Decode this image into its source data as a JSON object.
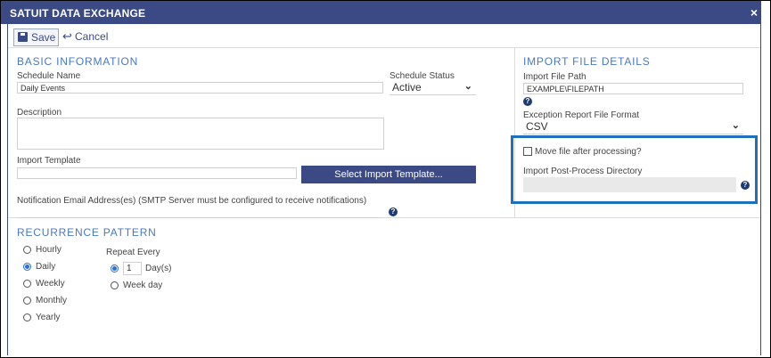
{
  "window": {
    "title": "SATUIT DATA EXCHANGE",
    "close_glyph": "×"
  },
  "toolbar": {
    "save_label": "Save",
    "cancel_label": "Cancel"
  },
  "basic_info": {
    "title": "BASIC INFORMATION",
    "schedule_name_label": "Schedule Name",
    "schedule_name_value": "Daily Events",
    "schedule_status_label": "Schedule Status",
    "schedule_status_value": "Active",
    "description_label": "Description",
    "import_template_label": "Import Template",
    "select_template_button": "Select Import Template...",
    "notification_label": "Notification Email Address(es)   (SMTP Server must be configured to receive notifications)"
  },
  "import_details": {
    "title": "IMPORT FILE DETAILS",
    "file_path_label": "Import File Path",
    "file_path_value": "EXAMPLE\\FILEPATH",
    "exception_format_label": "Exception Report File Format",
    "exception_format_value": "CSV",
    "move_file_label": "Move file after processing?",
    "move_file_checked": false,
    "post_process_dir_label": "Import Post-Process Directory"
  },
  "recurrence": {
    "title": "RECURRENCE PATTERN",
    "options": [
      {
        "label": "Hourly",
        "selected": false
      },
      {
        "label": "Daily",
        "selected": true
      },
      {
        "label": "Weekly",
        "selected": false
      },
      {
        "label": "Monthly",
        "selected": false
      },
      {
        "label": "Yearly",
        "selected": false
      }
    ],
    "repeat_every_label": "Repeat Every",
    "days_value": "1",
    "days_unit": "Day(s)",
    "week_day_label": "Week day"
  },
  "icons": {
    "help": "?",
    "chevron": "⌄",
    "cancel_arrow": "↩"
  },
  "colors": {
    "title_bar": "#3b4a84",
    "section_title": "#4a78c2",
    "highlight_border": "#1f6fbf",
    "primary_button": "#3b4a84"
  }
}
